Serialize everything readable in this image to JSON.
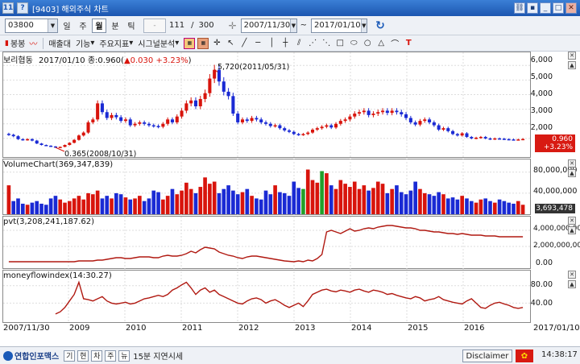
{
  "window": {
    "title": "[9403] 해외주식 차트",
    "icon_label": "11",
    "menu_glyph": "?"
  },
  "toolbar": {
    "code": "03800",
    "periods": [
      "일",
      "주",
      "월",
      "분",
      "틱"
    ],
    "active_period": "월",
    "count": "111",
    "total": "300",
    "start_date": "2007/11/30",
    "end_date": "2017/01/10"
  },
  "toolbar2": {
    "items": [
      "봉봉",
      "매출대",
      "기능",
      "주요지표",
      "시그널분석"
    ],
    "chart_icon": "LINE"
  },
  "panels": {
    "price": {
      "name": "보리협동",
      "date": "2017/01/10",
      "info": "종:0.960(",
      "change": "0.030",
      "pct": "+3.23%",
      "close_suffix": ")",
      "high_annot": "5,720(2011/05/31)",
      "low_annot": "0.365(2008/10/31)",
      "yticks": [
        "6,000",
        "5,000",
        "4,000",
        "3,000",
        "2,000",
        "1,000"
      ],
      "badge_price": "0.960",
      "badge_pct": "+3.23%"
    },
    "volume": {
      "label": "VolumeChart(369,347,839)",
      "yticks": [
        "80,000,000",
        "40,000,000"
      ],
      "badge": "3,693,478"
    },
    "pvt": {
      "label": "pvt(3,208,241,187.62)",
      "yticks": [
        "4,000,000,000",
        "2,000,000,000",
        "0.00"
      ]
    },
    "mfi": {
      "label": "moneyflowindex(14:30.27)",
      "yticks": [
        "80.00",
        "40.00"
      ]
    }
  },
  "xaxis": [
    "2007/11/30",
    "2009",
    "2010",
    "2011",
    "2012",
    "2013",
    "2014",
    "2015",
    "2016",
    "2017/01/10"
  ],
  "statusbar": {
    "logo": "연합인포맥스",
    "buttons": [
      "기",
      "현",
      "차",
      "주",
      "뉴"
    ],
    "delay": "15분 지연시세",
    "disclaimer": "Disclaimer",
    "time": "14:38:17"
  },
  "colors": {
    "up": "#d8140c",
    "down": "#1a2ad4",
    "line": "#b01810",
    "title_bar": "#1c56b0"
  },
  "chart_data": {
    "type": "candlestick",
    "y_range": [
      0,
      6.4
    ],
    "monthly_close": [
      1.25,
      1.15,
      0.95,
      0.9,
      0.95,
      0.85,
      0.65,
      0.55,
      0.5,
      0.45,
      0.38,
      0.42,
      0.55,
      0.7,
      0.9,
      1.2,
      1.4,
      2.1,
      2.3,
      3.4,
      2.8,
      2.4,
      2.6,
      2.45,
      2.2,
      2.3,
      1.9,
      2.0,
      2.1,
      2.0,
      1.9,
      1.85,
      1.8,
      2.0,
      2.3,
      2.1,
      2.5,
      2.9,
      3.4,
      3.6,
      3.2,
      3.7,
      4.1,
      5.1,
      5.7,
      4.9,
      4.2,
      3.9,
      2.7,
      2.1,
      2.3,
      2.2,
      2.4,
      2.3,
      2.1,
      2.0,
      1.85,
      1.9,
      1.7,
      1.55,
      1.45,
      1.3,
      1.25,
      1.3,
      1.4,
      1.6,
      1.7,
      1.8,
      1.9,
      1.75,
      2.0,
      2.2,
      2.3,
      2.5,
      2.7,
      2.8,
      2.9,
      2.6,
      2.7,
      2.8,
      2.9,
      2.75,
      2.9,
      2.8,
      2.65,
      2.4,
      2.1,
      1.95,
      2.2,
      2.3,
      2.1,
      1.9,
      1.6,
      1.7,
      1.5,
      1.3,
      1.2,
      1.35,
      1.1,
      1.0,
      1.05,
      1.1,
      1.0,
      0.95,
      1.0,
      0.98,
      0.95,
      0.93,
      0.92,
      0.93,
      0.96
    ],
    "volume_millions": [
      55,
      25,
      30,
      20,
      18,
      22,
      25,
      20,
      18,
      30,
      35,
      28,
      22,
      25,
      30,
      35,
      28,
      40,
      38,
      45,
      30,
      35,
      30,
      40,
      38,
      32,
      28,
      30,
      35,
      25,
      30,
      45,
      42,
      28,
      35,
      48,
      38,
      45,
      60,
      48,
      40,
      52,
      70,
      58,
      62,
      40,
      48,
      55,
      45,
      38,
      42,
      48,
      35,
      30,
      28,
      45,
      38,
      55,
      42,
      40,
      35,
      62,
      50,
      48,
      85,
      65,
      60,
      82,
      78,
      55,
      48,
      65,
      58,
      52,
      62,
      48,
      55,
      45,
      50,
      62,
      58,
      40,
      48,
      55,
      42,
      38,
      45,
      62,
      48,
      40,
      38,
      35,
      42,
      38,
      30,
      32,
      28,
      35,
      30,
      25,
      22,
      28,
      30,
      25,
      22,
      28,
      25,
      22,
      20,
      25,
      18
    ],
    "volume_colors": "mixed",
    "pvt_billions": [
      0.1,
      0.1,
      0.1,
      0.1,
      0.1,
      0.1,
      0.1,
      0.1,
      0.1,
      0.1,
      0.1,
      0.1,
      0.1,
      0.1,
      0.1,
      0.2,
      0.2,
      0.2,
      0.2,
      0.3,
      0.3,
      0.4,
      0.5,
      0.6,
      0.6,
      0.5,
      0.5,
      0.6,
      0.7,
      0.7,
      0.7,
      0.6,
      0.6,
      0.8,
      0.9,
      0.8,
      0.8,
      0.9,
      1.1,
      1.4,
      1.2,
      1.6,
      1.9,
      1.8,
      1.7,
      1.3,
      1.1,
      0.9,
      0.8,
      0.6,
      0.5,
      0.7,
      0.8,
      0.8,
      0.7,
      0.6,
      0.5,
      0.4,
      0.3,
      0.2,
      0.15,
      0.1,
      0.2,
      0.1,
      0.3,
      0.2,
      0.5,
      1.0,
      3.8,
      4.0,
      3.8,
      3.6,
      3.9,
      4.2,
      3.9,
      4.0,
      4.2,
      4.3,
      4.2,
      4.4,
      4.5,
      4.6,
      4.6,
      4.5,
      4.4,
      4.3,
      4.3,
      4.2,
      4.0,
      4.0,
      3.9,
      3.8,
      3.8,
      3.7,
      3.6,
      3.6,
      3.5,
      3.6,
      3.5,
      3.4,
      3.4,
      3.4,
      3.3,
      3.3,
      3.3,
      3.2,
      3.2,
      3.2,
      3.2,
      3.2,
      3.2
    ],
    "mfi": [
      null,
      null,
      null,
      null,
      null,
      null,
      null,
      null,
      null,
      null,
      15,
      20,
      30,
      45,
      60,
      88,
      50,
      48,
      45,
      50,
      55,
      45,
      40,
      38,
      40,
      42,
      38,
      40,
      45,
      50,
      52,
      55,
      58,
      55,
      60,
      70,
      75,
      82,
      88,
      75,
      60,
      70,
      75,
      65,
      70,
      60,
      55,
      50,
      45,
      40,
      38,
      45,
      50,
      52,
      48,
      40,
      45,
      48,
      42,
      35,
      30,
      35,
      40,
      32,
      45,
      60,
      65,
      70,
      72,
      68,
      66,
      70,
      68,
      65,
      70,
      72,
      68,
      65,
      70,
      68,
      65,
      60,
      62,
      58,
      55,
      52,
      50,
      55,
      52,
      45,
      48,
      50,
      55,
      48,
      45,
      42,
      40,
      38,
      45,
      50,
      40,
      30,
      28,
      35,
      40,
      42,
      38,
      35,
      30,
      28,
      30
    ]
  }
}
